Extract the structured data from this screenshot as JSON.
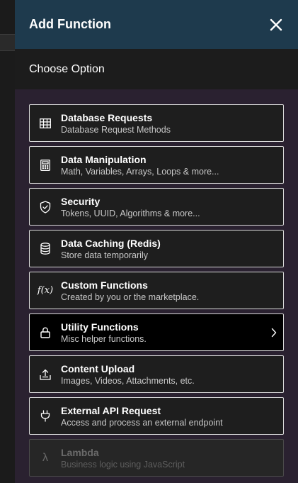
{
  "header": {
    "title": "Add Function",
    "close_icon": "close-icon"
  },
  "subheader": {
    "label": "Choose Option"
  },
  "options": [
    {
      "title": "Database Requests",
      "desc": "Database Request Methods",
      "icon": "table-grid-icon"
    },
    {
      "title": "Data Manipulation",
      "desc": "Math, Variables, Arrays, Loops & more...",
      "icon": "calculator-icon"
    },
    {
      "title": "Security",
      "desc": "Tokens, UUID, Algorithms & more...",
      "icon": "shield-check-icon"
    },
    {
      "title": "Data Caching (Redis)",
      "desc": "Store data temporarily",
      "icon": "database-icon"
    },
    {
      "title": "Custom Functions",
      "desc": "Created by you or the marketplace.",
      "icon": "function-icon",
      "icon_text": "f(x)"
    },
    {
      "title": "Utility Functions",
      "desc": "Misc helper functions.",
      "icon": "lock-icon",
      "selected": true
    },
    {
      "title": "Content Upload",
      "desc": "Images, Videos, Attachments, etc.",
      "icon": "upload-icon"
    },
    {
      "title": "External API Request",
      "desc": "Access and process an external endpoint",
      "icon": "plug-icon"
    },
    {
      "title": "Lambda",
      "desc": "Business logic using JavaScript",
      "icon": "lambda-icon",
      "icon_text": "λ",
      "disabled": true
    }
  ],
  "colors": {
    "header_bg": "#1e3a4d",
    "panel_bg": "#2a2130",
    "subheader_bg": "#1c1c1c",
    "option_bg": "#1e1e1e",
    "option_active_bg": "#000000",
    "option_border": "#d9d9d9",
    "text_primary": "#ffffff",
    "text_secondary": "#c8c8c8",
    "text_disabled": "#6a6a6a"
  }
}
